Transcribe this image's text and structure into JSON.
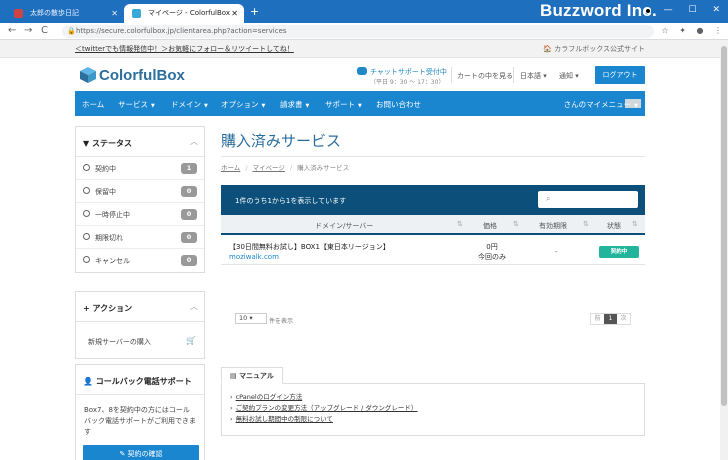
{
  "browser": {
    "tabs": [
      {
        "title": "太郎の散歩日記"
      },
      {
        "title": "マイページ - ColorfulBox"
      }
    ],
    "new_tab": "+",
    "overlay_brand": "Buzzword Inc.",
    "url": "https://secure.colorfulbox.jp/clientarea.php?action=services",
    "nav": {
      "back": "←",
      "forward": "→",
      "reload": "C"
    }
  },
  "site": {
    "top_strip": {
      "promo": "＜twitterでも情報発信中！＞お気軽にフォロー＆リツイートしてね！",
      "official": "カラフルボックス公式サイト"
    },
    "logo_text": "ColorfulBox",
    "chat": {
      "line1": "チャットサポート受付中",
      "line2": "（平日 9：30 ～ 17：30）"
    },
    "header_links": {
      "cart": "カートの中を見る",
      "language": "日本語",
      "notify": "通知",
      "logout": "ログアウト"
    },
    "nav": [
      {
        "label": "ホーム",
        "caret": ""
      },
      {
        "label": "サービス",
        "caret": "▼"
      },
      {
        "label": "ドメイン",
        "caret": "▼"
      },
      {
        "label": "オプション",
        "caret": "▼"
      },
      {
        "label": "請求書",
        "caret": "▼"
      },
      {
        "label": "サポート",
        "caret": "▼"
      },
      {
        "label": "お問い合わせ",
        "caret": ""
      }
    ],
    "user_menu": "さんのマイメニュー",
    "user_caret": "▼"
  },
  "sidebar": {
    "status": {
      "title": "ステータス",
      "items": [
        {
          "label": "契約中",
          "count": "1"
        },
        {
          "label": "保留中",
          "count": "0"
        },
        {
          "label": "一時停止中",
          "count": "0"
        },
        {
          "label": "期限切れ",
          "count": "0"
        },
        {
          "label": "キャンセル",
          "count": "0"
        }
      ]
    },
    "actions": {
      "title": "アクション",
      "items": [
        {
          "label": "新規サーバーの購入"
        }
      ]
    },
    "callback": {
      "title": "コールバック電話サポート",
      "body": "Box7、8を契約中の方にはコールバック電話サポートがご利用できます",
      "button": "契約の確認"
    }
  },
  "main": {
    "title": "購入済みサービス",
    "breadcrumb": [
      "ホーム",
      "マイページ",
      "購入済みサービス"
    ],
    "table": {
      "info": "1件のうち1から1を表示しています",
      "headers": [
        "ドメイン/サーバー",
        "価格",
        "有効期限",
        "状態"
      ],
      "rows": [
        {
          "product": "【30日間無料お試し】BOX1【東日本リージョン】",
          "domain": "moziwalk.com",
          "price": "0円",
          "cycle": "今回のみ",
          "due": "-",
          "status": "契約中"
        }
      ],
      "page_length": "10",
      "page_length_suffix": "件を表示",
      "pager": [
        "前",
        "1",
        "次"
      ]
    },
    "manual": {
      "tab": "マニュアル",
      "links": [
        "cPanelのログイン方法",
        "ご契約プランの変更方法（アップグレード / ダウングレード）",
        "無料お試し期間中の制限について"
      ]
    }
  },
  "colors": {
    "primary": "#1a86d0",
    "dark": "#0b4f7a",
    "success": "#22b59b",
    "chrome": "#1f6fbf"
  }
}
